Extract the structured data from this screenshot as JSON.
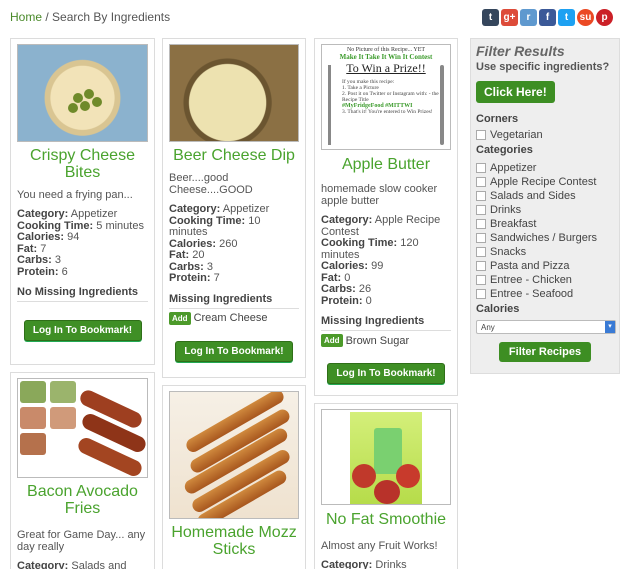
{
  "breadcrumb": {
    "home": "Home",
    "separator": " / ",
    "current": "Search By Ingredients"
  },
  "social": [
    {
      "icon": "tumblr-icon",
      "glyph": "t",
      "color": "#35465c"
    },
    {
      "icon": "google-plus-icon",
      "glyph": "g+",
      "color": "#dd4b39"
    },
    {
      "icon": "reddit-icon",
      "glyph": "r",
      "color": "#5f99cf"
    },
    {
      "icon": "facebook-icon",
      "glyph": "f",
      "color": "#3b5998"
    },
    {
      "icon": "twitter-icon",
      "glyph": "t",
      "color": "#1da1f2"
    },
    {
      "icon": "stumbleupon-icon",
      "glyph": "su",
      "color": "#eb4924"
    },
    {
      "icon": "pinterest-icon",
      "glyph": "p",
      "color": "#cb2027"
    }
  ],
  "labels": {
    "category": "Category:",
    "cooking_time": "Cooking Time:",
    "calories": "Calories:",
    "fat": "Fat:",
    "carbs": "Carbs:",
    "protein": "Protein:",
    "missing_ingredients": "Missing Ingredients",
    "no_missing": "No Missing Ingredients",
    "add": "Add",
    "bookmark": "Log In To Bookmark!"
  },
  "recipes": [
    {
      "title": "Crispy Cheese Bites",
      "desc": "You need a frying pan...",
      "category": "Appetizer",
      "cooking_time": "5 minutes",
      "calories": "94",
      "fat": "7",
      "carbs": "3",
      "protein": "6"
    },
    {
      "title": "Beer Cheese Dip",
      "desc": "Beer....good Cheese....GOOD",
      "category": "Appetizer",
      "cooking_time": "10 minutes",
      "calories": "260",
      "fat": "20",
      "carbs": "3",
      "protein": "7",
      "missing": "Cream Cheese"
    },
    {
      "title": "Apple Butter",
      "desc": "homemade slow cooker apple butter",
      "category": "Apple Recipe Contest",
      "cooking_time": "120 minutes",
      "calories": "99",
      "fat": "0",
      "carbs": "26",
      "protein": "0",
      "missing": "Brown Sugar",
      "image_text": {
        "line1": "No Picture of this Recipe... YET",
        "line2": "Make It Take It Win It Contest",
        "line3": "To Win a Prize!!",
        "line4": "If you make this recipe:",
        "line5": "1. Take a Picture",
        "line6": "2. Post it on Twitter or Instagram with: - the Recipe Title",
        "line7": "#MyFridgeFood #MITTWI",
        "line8": "3. That's it! You're entered to Win Prizes!"
      }
    },
    {
      "title": "Bacon Avocado Fries",
      "desc": "Great for Game Day... any day really",
      "category": "Salads and"
    },
    {
      "title": "Homemade Mozz Sticks"
    },
    {
      "title": "No Fat Smoothie",
      "desc": "Almost any Fruit Works!",
      "category": "Drinks"
    }
  ],
  "filter": {
    "title": "Filter Results",
    "subtitle": "Use specific ingredients?",
    "click_here": "Click Here!",
    "corners_label": "Corners",
    "corners": [
      "Vegetarian"
    ],
    "categories_label": "Categories",
    "categories": [
      "Appetizer",
      "Apple Recipe Contest",
      "Salads and Sides",
      "Drinks",
      "Breakfast",
      "Sandwiches / Burgers",
      "Snacks",
      "Pasta and Pizza",
      "Entree - Chicken",
      "Entree - Seafood"
    ],
    "calories_label": "Calories",
    "calories_selected": "Any",
    "submit": "Filter Recipes"
  }
}
